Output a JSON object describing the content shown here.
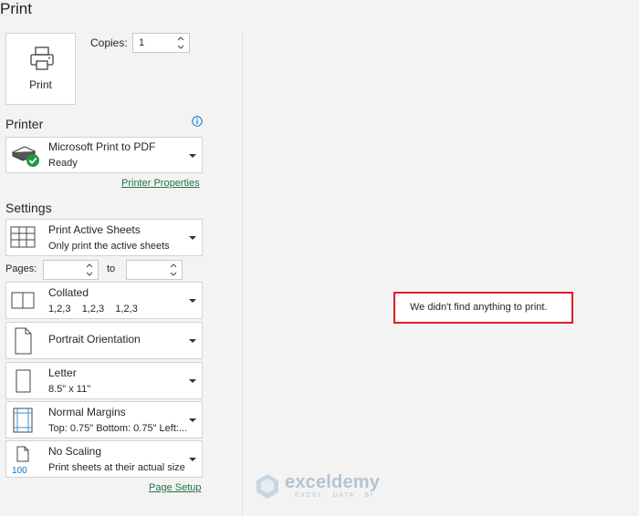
{
  "title": "Print",
  "print_button": {
    "label": "Print"
  },
  "copies": {
    "label": "Copies:",
    "value": "1"
  },
  "printer": {
    "section_title": "Printer",
    "name": "Microsoft Print to PDF",
    "status": "Ready",
    "properties_link": "Printer Properties"
  },
  "settings": {
    "section_title": "Settings",
    "what": {
      "line1": "Print Active Sheets",
      "line2": "Only print the active sheets"
    },
    "pages": {
      "label": "Pages:",
      "from": "",
      "to_label": "to",
      "to": ""
    },
    "collation": {
      "line1": "Collated",
      "line2": "1,2,3    1,2,3    1,2,3"
    },
    "orientation": {
      "line1": "Portrait Orientation"
    },
    "paper": {
      "line1": "Letter",
      "line2": "8.5\" x 11\""
    },
    "margins": {
      "line1": "Normal Margins",
      "line2": "Top: 0.75\" Bottom: 0.75\" Left:..."
    },
    "scaling": {
      "line1": "No Scaling",
      "line2": "Print sheets at their actual size",
      "icon_text": "100"
    },
    "page_setup_link": "Page Setup"
  },
  "preview": {
    "message": "We didn't find anything to print."
  },
  "watermark": {
    "name": "exceldemy",
    "tagline": "EXCEL · DATA · BI"
  },
  "colors": {
    "link": "#217346",
    "highlight_border": "#e01c24",
    "accent_blue": "#0078d4"
  }
}
